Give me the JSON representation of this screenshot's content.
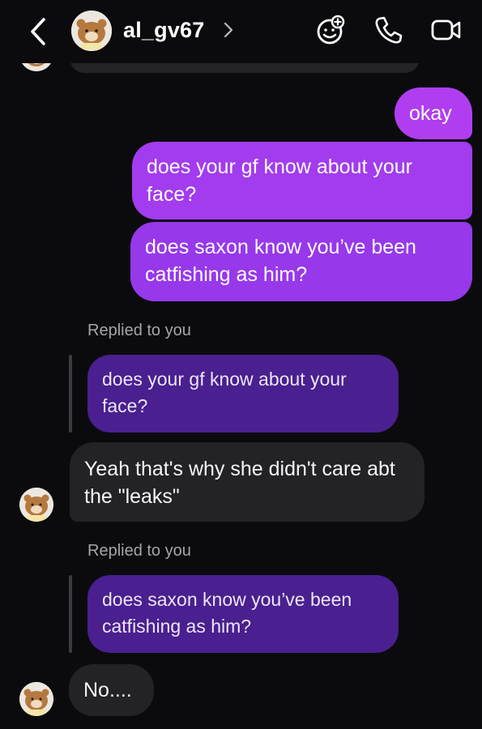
{
  "header": {
    "username": "al_gv67",
    "icons": [
      "back-arrow-icon",
      "avatar",
      "chevron-right-icon",
      "sticker-icon",
      "phone-icon",
      "video-icon"
    ]
  },
  "messages": [
    {
      "from": "me",
      "text": "okay"
    },
    {
      "from": "me",
      "text": "does your gf know about your face?"
    },
    {
      "from": "me",
      "text": "does saxon know you’ve been catfishing as him?"
    },
    {
      "from": "them",
      "reply_label": "Replied to you",
      "quoted": "does your gf know about your face?",
      "text": "Yeah that's why she didn't care abt the \"leaks\""
    },
    {
      "from": "them",
      "reply_label": "Replied to you",
      "quoted": "does saxon know you’ve been catfishing as him?",
      "text": "No...."
    }
  ],
  "colors": {
    "background": "#0b0b0d",
    "sent_bubble": "#a23cee",
    "received_bubble": "#232326",
    "reply_quote": "#4a1f8f"
  }
}
